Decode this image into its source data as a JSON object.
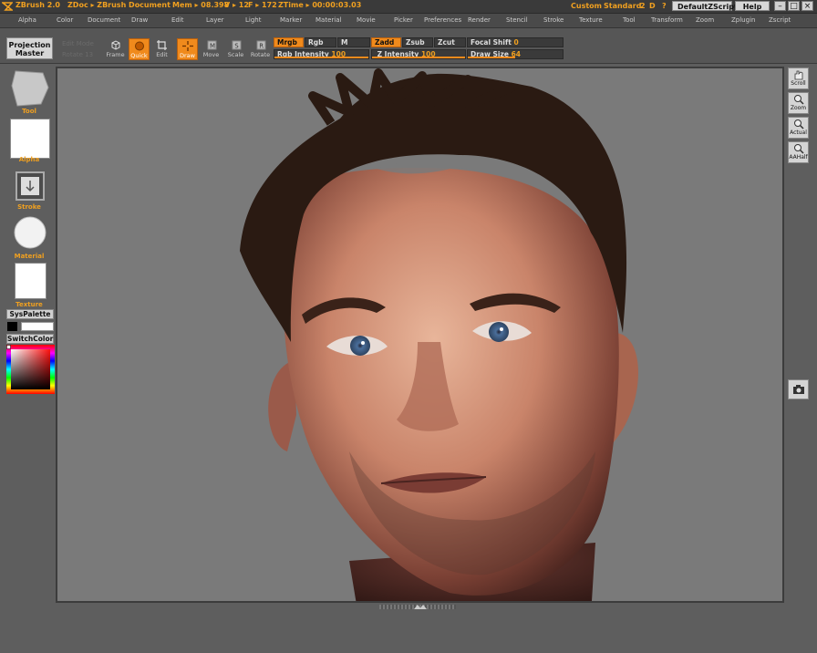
{
  "app": {
    "title": "ZBrush 2.0",
    "document": "ZDoc ▸ ZBrush Document",
    "mem": "Mem ▸ 08.398",
    "verts": "V ▸ 12",
    "faces": "F ▸ 172",
    "ztime": "ZTime ▸ 00:00:03.03",
    "layout_custom": "Custom",
    "layout_standard": "Standard",
    "layout_2": "2",
    "layout_d": "D",
    "help_q": "?",
    "default_script": "DefaultZScript",
    "help": "Help",
    "win_min": "–",
    "win_max": "□",
    "win_close": "×"
  },
  "menu": {
    "items": [
      "Alpha",
      "Color",
      "Document",
      "Draw",
      "Edit",
      "Layer",
      "Light",
      "Marker",
      "Material",
      "Movie",
      "Picker",
      "Preferences",
      "Render",
      "Stencil",
      "Stroke",
      "Texture",
      "Tool",
      "Transform",
      "Zoom",
      "Zplugin",
      "Zscript"
    ]
  },
  "toolbar": {
    "projection_master": [
      "Projection",
      "Master"
    ],
    "ghost_text": [
      "Edit Mode",
      "Rotate 13"
    ],
    "buttons": [
      {
        "label": "Frame",
        "icon": "frame-cube-icon"
      },
      {
        "label": "Quick",
        "icon": "quick-sphere-icon",
        "active": true
      },
      {
        "label": "Edit",
        "icon": "edit-crop-icon"
      },
      {
        "label": "Draw",
        "icon": "draw-crosshair-icon",
        "active": true
      },
      {
        "label": "Move",
        "icon": "move-icon"
      },
      {
        "label": "Scale",
        "icon": "scale-icon"
      },
      {
        "label": "Rotate",
        "icon": "rotate-icon"
      }
    ],
    "mrgb": "Mrgb",
    "rgb": "Rgb",
    "m": "M",
    "zadd": "Zadd",
    "zsub": "Zsub",
    "zcut": "Zcut",
    "focal_shift_label": "Focal Shift",
    "focal_shift_value": "0",
    "rgb_intensity_label": "Rgb Intensity",
    "rgb_intensity_value": "100",
    "z_intensity_label": "Z Intensity",
    "z_intensity_value": "100",
    "draw_size_label": "Draw Size",
    "draw_size_value": "64"
  },
  "left_panel": {
    "tool_label": "Tool",
    "alpha_label": "Alpha",
    "stroke_label": "Stroke",
    "material_label": "Material",
    "texture_label": "Texture",
    "syspalette": "SysPalette",
    "switchcolor": "SwitchColor"
  },
  "right_panel": {
    "buttons": [
      {
        "label": "Scroll",
        "icon": "hand-scroll-icon"
      },
      {
        "label": "Zoom",
        "icon": "zoom-icon"
      },
      {
        "label": "Actual",
        "icon": "actual-icon"
      },
      {
        "label": "AAHalf",
        "icon": "aahalf-icon"
      }
    ],
    "snapshot_icon": "camera-icon"
  },
  "colors": {
    "accent": "#f08a1c",
    "canvas_bg": "#7a7a7a",
    "ui_bg": "#565656"
  }
}
